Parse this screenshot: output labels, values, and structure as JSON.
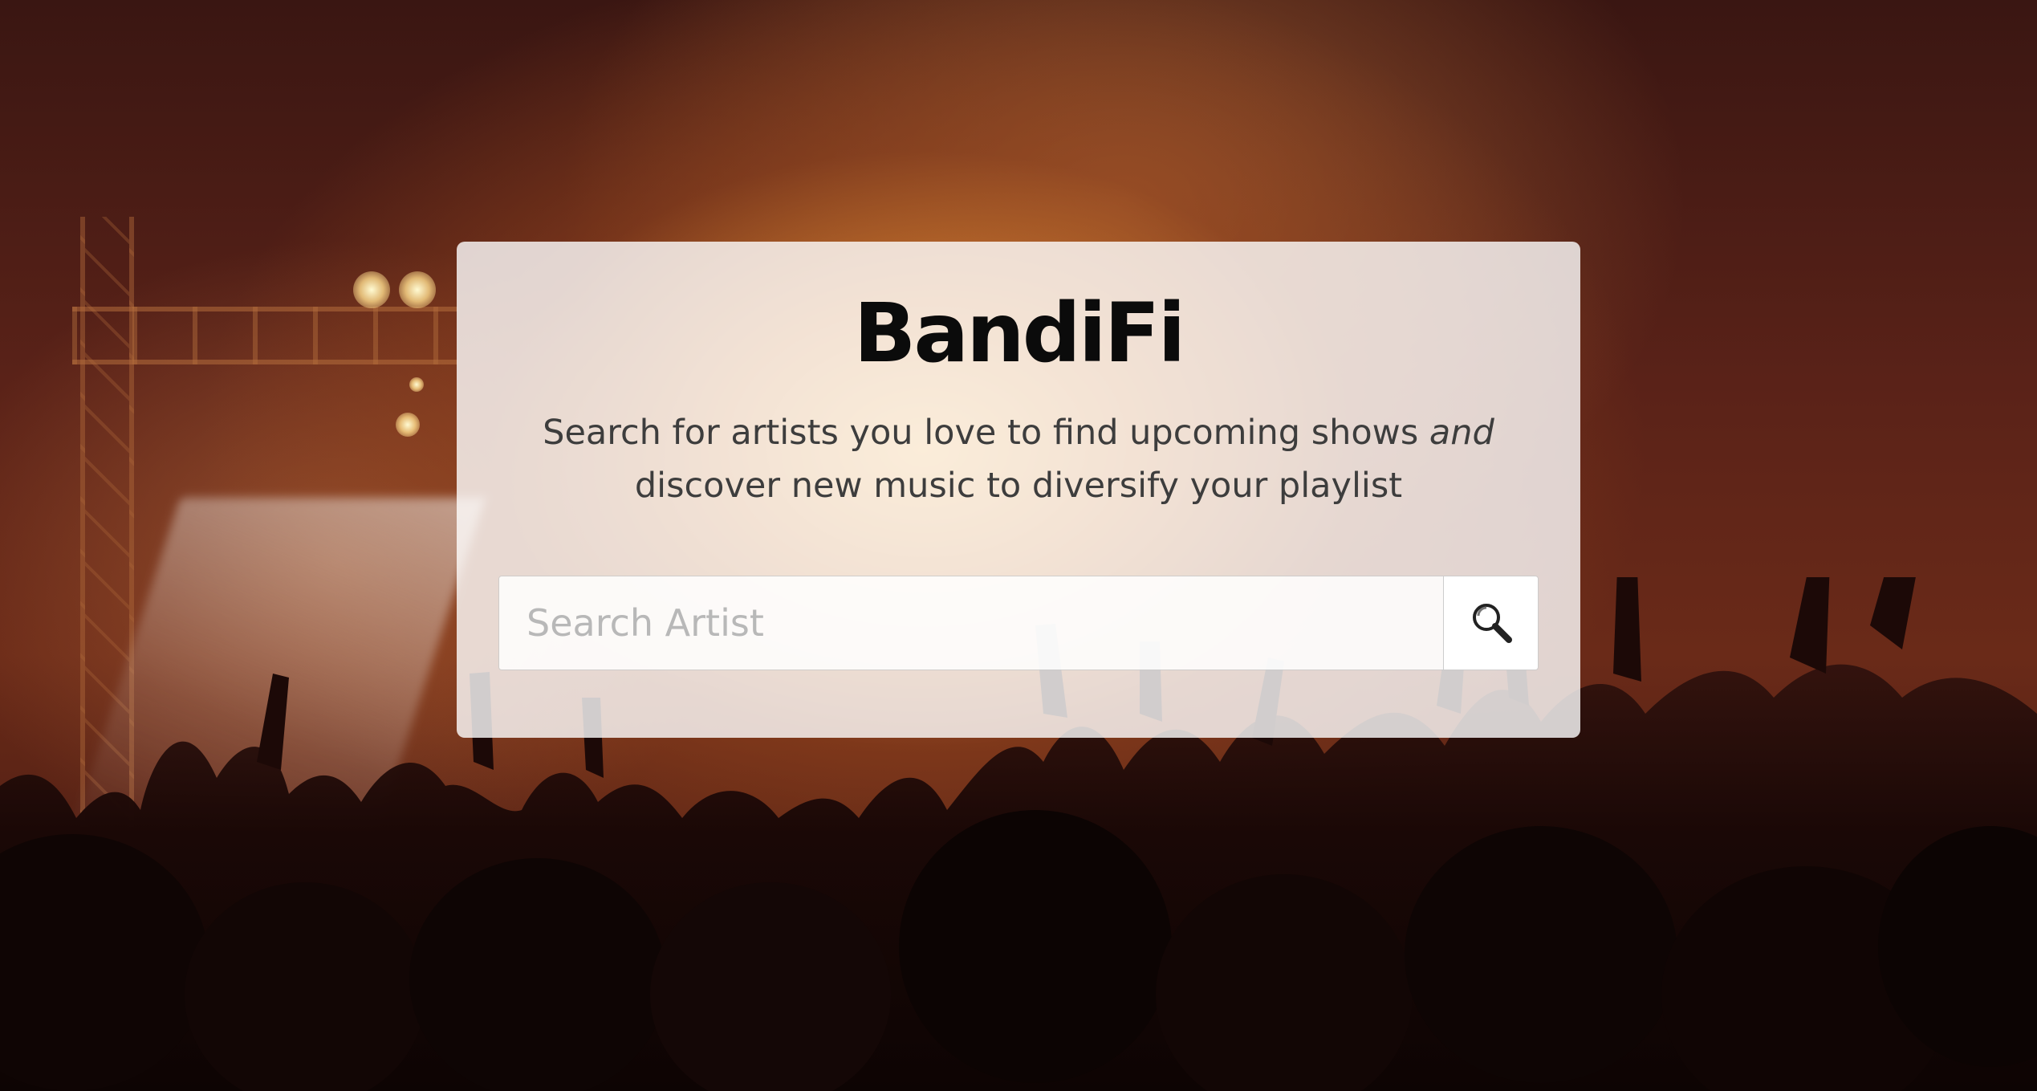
{
  "brand": {
    "name": "BandiFi"
  },
  "hero": {
    "tagline_part1": "Search for artists you love to find upcoming shows ",
    "tagline_emphasis": "and",
    "tagline_part2": " discover new music to diversify your playlist"
  },
  "search": {
    "placeholder": "Search Artist",
    "value": "",
    "button_icon": "search-icon"
  },
  "colors": {
    "card_background": "#ffffff",
    "brand_text": "#0b0b0b",
    "tagline_text": "#3d3d3d",
    "placeholder_text": "#b8b8b8",
    "background_glow": "#e8a24a"
  }
}
